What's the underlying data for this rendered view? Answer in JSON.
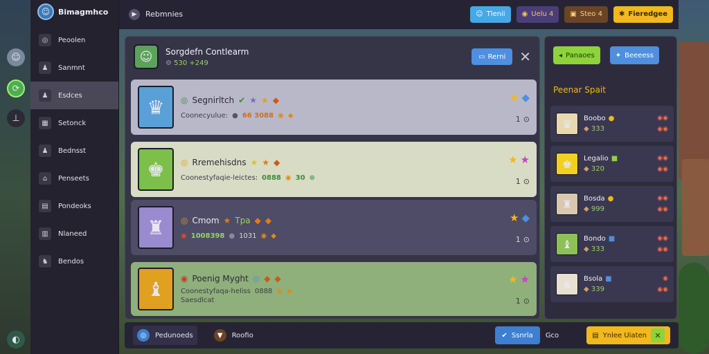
{
  "colors": {
    "gold": "#f2b81c",
    "green": "#8ed33a",
    "blue": "#4e8fe0",
    "panel": "#363447"
  },
  "sidebar": {
    "title": "Bimagmhco",
    "items": [
      {
        "label": "Peoolen",
        "icon": "profile-icon"
      },
      {
        "label": "Sanmnt",
        "icon": "person-icon"
      },
      {
        "label": "Esdces",
        "icon": "person-icon"
      },
      {
        "label": "Setonck",
        "icon": "crate-icon"
      },
      {
        "label": "Bednsst",
        "icon": "person-icon"
      },
      {
        "label": "Penseets",
        "icon": "house-icon"
      },
      {
        "label": "Pondeoks",
        "icon": "map-icon"
      },
      {
        "label": "Nlaneed",
        "icon": "building-icon"
      },
      {
        "label": "Bendos",
        "icon": "people-icon"
      }
    ]
  },
  "topbar": {
    "title": "Rebmnies",
    "profile_label": "Tlenii",
    "stat1": "Uelu  4",
    "stat2": "Steo  4",
    "gold_label": "Fieredgee"
  },
  "main": {
    "header_title": "Sorgdefn Contlearm",
    "header_value": "530 +249",
    "header_button": "Rerni",
    "rows": [
      {
        "name": "Segnirltch",
        "meta_label": "Coonecyulue:",
        "meta_value": "66 3088",
        "count": "1"
      },
      {
        "name": "Rremehisdns",
        "meta_label": "Coonestyfaqie-leictes:",
        "meta_value": "0888",
        "meta_extra": "30",
        "count": "1"
      },
      {
        "name": "Cmom",
        "name_extra": "Tpa",
        "meta_label": "1008398",
        "meta_value": "1031",
        "count": "1"
      },
      {
        "name": "Poenig Myght",
        "meta_label": "Coonestyfaqa-heliss",
        "meta_value": "0888",
        "meta_line2": "Saesdlcat",
        "count": "1"
      }
    ]
  },
  "side": {
    "tab1": "Panaoes",
    "tab2": "Beeeess",
    "title": "Peenar Spait",
    "items": [
      {
        "name": "Boobo",
        "value": "333"
      },
      {
        "name": "Legalio",
        "value": "320"
      },
      {
        "name": "Bosda",
        "value": "999"
      },
      {
        "name": "Bondo",
        "value": "333"
      },
      {
        "name": "Bsola",
        "value": "339"
      }
    ]
  },
  "bottombar": {
    "item1": "Pedunoeds",
    "item2": "Roofio",
    "blue_label": "Ssnrla",
    "blue_extra": "Gco",
    "gold_label": "Ynlee Uiaten"
  }
}
